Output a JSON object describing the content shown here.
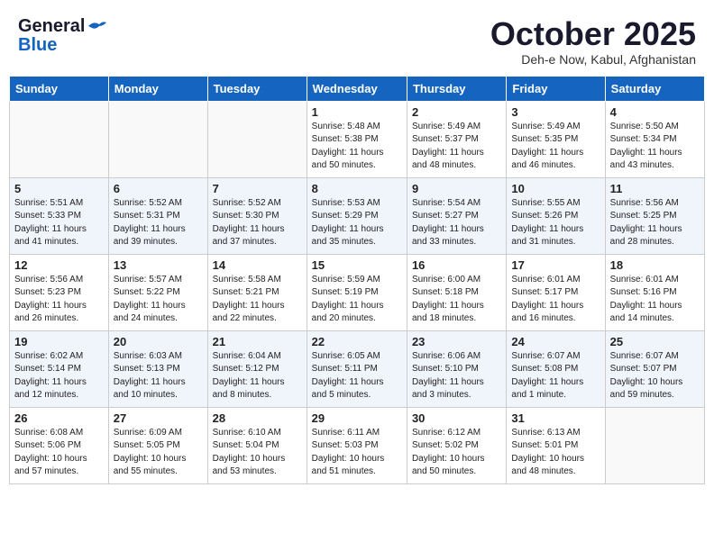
{
  "header": {
    "logo_general": "General",
    "logo_blue": "Blue",
    "month": "October 2025",
    "location": "Deh-e Now, Kabul, Afghanistan"
  },
  "weekdays": [
    "Sunday",
    "Monday",
    "Tuesday",
    "Wednesday",
    "Thursday",
    "Friday",
    "Saturday"
  ],
  "weeks": [
    [
      {
        "day": "",
        "info": ""
      },
      {
        "day": "",
        "info": ""
      },
      {
        "day": "",
        "info": ""
      },
      {
        "day": "1",
        "info": "Sunrise: 5:48 AM\nSunset: 5:38 PM\nDaylight: 11 hours\nand 50 minutes."
      },
      {
        "day": "2",
        "info": "Sunrise: 5:49 AM\nSunset: 5:37 PM\nDaylight: 11 hours\nand 48 minutes."
      },
      {
        "day": "3",
        "info": "Sunrise: 5:49 AM\nSunset: 5:35 PM\nDaylight: 11 hours\nand 46 minutes."
      },
      {
        "day": "4",
        "info": "Sunrise: 5:50 AM\nSunset: 5:34 PM\nDaylight: 11 hours\nand 43 minutes."
      }
    ],
    [
      {
        "day": "5",
        "info": "Sunrise: 5:51 AM\nSunset: 5:33 PM\nDaylight: 11 hours\nand 41 minutes."
      },
      {
        "day": "6",
        "info": "Sunrise: 5:52 AM\nSunset: 5:31 PM\nDaylight: 11 hours\nand 39 minutes."
      },
      {
        "day": "7",
        "info": "Sunrise: 5:52 AM\nSunset: 5:30 PM\nDaylight: 11 hours\nand 37 minutes."
      },
      {
        "day": "8",
        "info": "Sunrise: 5:53 AM\nSunset: 5:29 PM\nDaylight: 11 hours\nand 35 minutes."
      },
      {
        "day": "9",
        "info": "Sunrise: 5:54 AM\nSunset: 5:27 PM\nDaylight: 11 hours\nand 33 minutes."
      },
      {
        "day": "10",
        "info": "Sunrise: 5:55 AM\nSunset: 5:26 PM\nDaylight: 11 hours\nand 31 minutes."
      },
      {
        "day": "11",
        "info": "Sunrise: 5:56 AM\nSunset: 5:25 PM\nDaylight: 11 hours\nand 28 minutes."
      }
    ],
    [
      {
        "day": "12",
        "info": "Sunrise: 5:56 AM\nSunset: 5:23 PM\nDaylight: 11 hours\nand 26 minutes."
      },
      {
        "day": "13",
        "info": "Sunrise: 5:57 AM\nSunset: 5:22 PM\nDaylight: 11 hours\nand 24 minutes."
      },
      {
        "day": "14",
        "info": "Sunrise: 5:58 AM\nSunset: 5:21 PM\nDaylight: 11 hours\nand 22 minutes."
      },
      {
        "day": "15",
        "info": "Sunrise: 5:59 AM\nSunset: 5:19 PM\nDaylight: 11 hours\nand 20 minutes."
      },
      {
        "day": "16",
        "info": "Sunrise: 6:00 AM\nSunset: 5:18 PM\nDaylight: 11 hours\nand 18 minutes."
      },
      {
        "day": "17",
        "info": "Sunrise: 6:01 AM\nSunset: 5:17 PM\nDaylight: 11 hours\nand 16 minutes."
      },
      {
        "day": "18",
        "info": "Sunrise: 6:01 AM\nSunset: 5:16 PM\nDaylight: 11 hours\nand 14 minutes."
      }
    ],
    [
      {
        "day": "19",
        "info": "Sunrise: 6:02 AM\nSunset: 5:14 PM\nDaylight: 11 hours\nand 12 minutes."
      },
      {
        "day": "20",
        "info": "Sunrise: 6:03 AM\nSunset: 5:13 PM\nDaylight: 11 hours\nand 10 minutes."
      },
      {
        "day": "21",
        "info": "Sunrise: 6:04 AM\nSunset: 5:12 PM\nDaylight: 11 hours\nand 8 minutes."
      },
      {
        "day": "22",
        "info": "Sunrise: 6:05 AM\nSunset: 5:11 PM\nDaylight: 11 hours\nand 5 minutes."
      },
      {
        "day": "23",
        "info": "Sunrise: 6:06 AM\nSunset: 5:10 PM\nDaylight: 11 hours\nand 3 minutes."
      },
      {
        "day": "24",
        "info": "Sunrise: 6:07 AM\nSunset: 5:08 PM\nDaylight: 11 hours\nand 1 minute."
      },
      {
        "day": "25",
        "info": "Sunrise: 6:07 AM\nSunset: 5:07 PM\nDaylight: 10 hours\nand 59 minutes."
      }
    ],
    [
      {
        "day": "26",
        "info": "Sunrise: 6:08 AM\nSunset: 5:06 PM\nDaylight: 10 hours\nand 57 minutes."
      },
      {
        "day": "27",
        "info": "Sunrise: 6:09 AM\nSunset: 5:05 PM\nDaylight: 10 hours\nand 55 minutes."
      },
      {
        "day": "28",
        "info": "Sunrise: 6:10 AM\nSunset: 5:04 PM\nDaylight: 10 hours\nand 53 minutes."
      },
      {
        "day": "29",
        "info": "Sunrise: 6:11 AM\nSunset: 5:03 PM\nDaylight: 10 hours\nand 51 minutes."
      },
      {
        "day": "30",
        "info": "Sunrise: 6:12 AM\nSunset: 5:02 PM\nDaylight: 10 hours\nand 50 minutes."
      },
      {
        "day": "31",
        "info": "Sunrise: 6:13 AM\nSunset: 5:01 PM\nDaylight: 10 hours\nand 48 minutes."
      },
      {
        "day": "",
        "info": ""
      }
    ]
  ]
}
